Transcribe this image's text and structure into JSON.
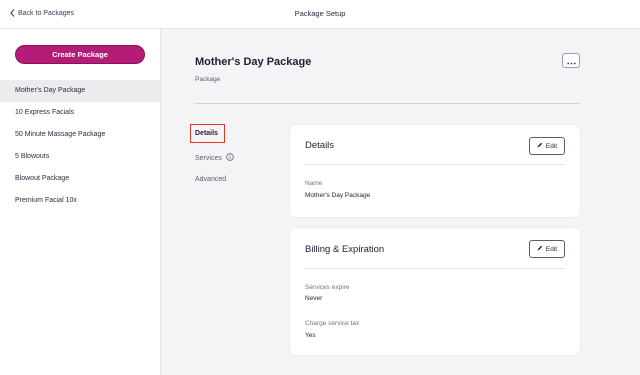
{
  "topbar": {
    "back_label": "Back to Packages",
    "title": "Package Setup"
  },
  "sidebar": {
    "create_label": "Create Package",
    "items": [
      {
        "label": "Mother's Day Package",
        "active": true
      },
      {
        "label": "10 Express Facials"
      },
      {
        "label": "50 Minute Massage Package"
      },
      {
        "label": "5 Blowouts"
      },
      {
        "label": "Blowout Package"
      },
      {
        "label": "Premium Facial 10x"
      }
    ]
  },
  "main": {
    "title": "Mother's Day Package",
    "subtitle": "Package",
    "subnav": {
      "details": "Details",
      "services": "Services",
      "advanced": "Advanced"
    },
    "details_card": {
      "title": "Details",
      "edit_label": "Edit",
      "fields": [
        {
          "label": "Name",
          "value": "Mother's Day Package"
        }
      ]
    },
    "billing_card": {
      "title": "Billing & Expiration",
      "edit_label": "Edit",
      "fields": [
        {
          "label": "Services expire",
          "value": "Never"
        },
        {
          "label": "Charge service tax",
          "value": "Yes"
        }
      ]
    }
  },
  "colors": {
    "accent": "#b41c77",
    "highlight_border": "#e0392b",
    "background": "#f4f4f6"
  },
  "icons": {
    "back": "chevron-left-icon",
    "more": "more-horizontal-icon",
    "info": "info-icon",
    "edit": "pencil-icon"
  }
}
